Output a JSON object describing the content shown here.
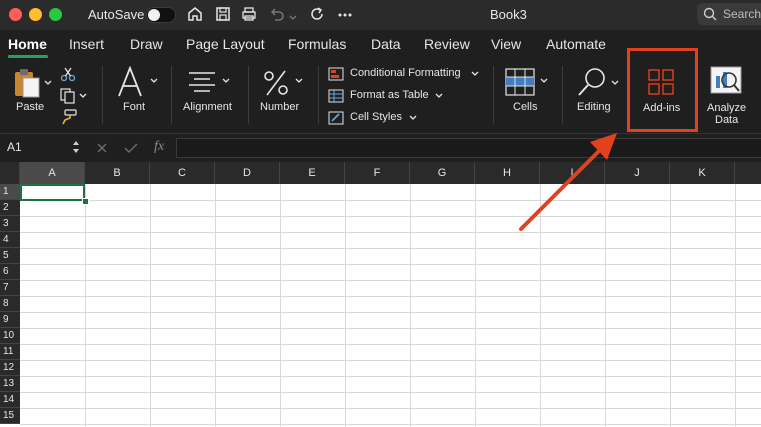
{
  "titlebar": {
    "autosave_label": "AutoSave",
    "window_title": "Book3",
    "search_placeholder": "Search"
  },
  "tabs": [
    {
      "label": "Home"
    },
    {
      "label": "Insert"
    },
    {
      "label": "Draw"
    },
    {
      "label": "Page Layout"
    },
    {
      "label": "Formulas"
    },
    {
      "label": "Data"
    },
    {
      "label": "Review"
    },
    {
      "label": "View"
    },
    {
      "label": "Automate"
    }
  ],
  "ribbon": {
    "paste": "Paste",
    "font": "Font",
    "alignment": "Alignment",
    "number": "Number",
    "conditional_formatting": "Conditional Formatting",
    "format_as_table": "Format as Table",
    "cell_styles": "Cell Styles",
    "cells": "Cells",
    "editing": "Editing",
    "addins": "Add-ins",
    "analyze_line1": "Analyze",
    "analyze_line2": "Data"
  },
  "formula_bar": {
    "name_box": "A1",
    "fx": "fx",
    "value": ""
  },
  "grid": {
    "columns": [
      "A",
      "B",
      "C",
      "D",
      "E",
      "F",
      "G",
      "H",
      "I",
      "J",
      "K"
    ],
    "rows": [
      "1",
      "2",
      "3",
      "4",
      "5",
      "6",
      "7",
      "8",
      "9",
      "10",
      "11",
      "12",
      "13",
      "14",
      "15"
    ],
    "selected_cell": "A1"
  },
  "colors": {
    "accent_green": "#1e7145",
    "highlight": "#e2411f"
  }
}
